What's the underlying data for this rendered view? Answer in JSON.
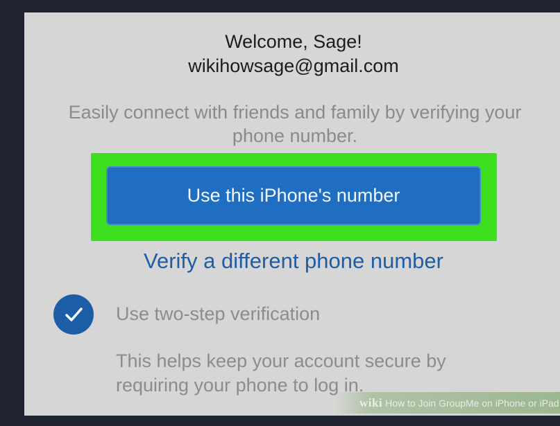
{
  "welcome": {
    "title": "Welcome, Sage!",
    "email": "wikihowsage@gmail.com"
  },
  "intro": {
    "text": "Easily connect with friends and family by verifying your phone number."
  },
  "actions": {
    "primary_label": "Use this iPhone's number",
    "secondary_link": "Verify a different phone number"
  },
  "two_step": {
    "label": "Use two-step verification",
    "help": "This helps keep your account secure by requiring your phone to log in.",
    "checked": true,
    "icon": "check-icon"
  },
  "watermark": {
    "brand": "wiki",
    "text": "How to Join GroupMe on iPhone or iPad"
  },
  "colors": {
    "highlight": "#3de01f",
    "primary": "#1f6ec2",
    "link": "#1f5da4",
    "checkbox": "#1b5ea5",
    "screen": "#d6d6d6"
  }
}
